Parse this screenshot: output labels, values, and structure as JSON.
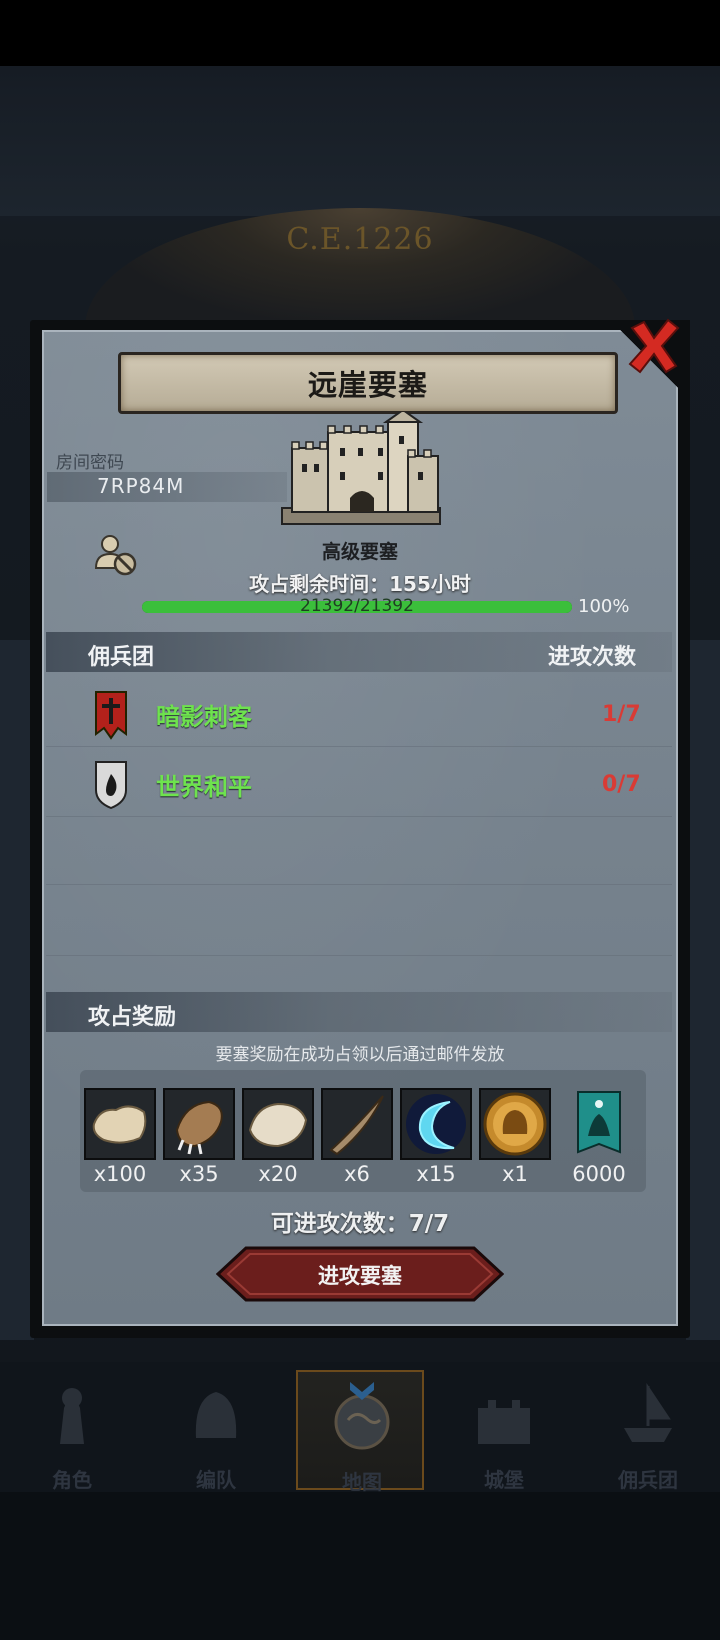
{
  "background": {
    "dial_year": "C.E.1226"
  },
  "fortress": {
    "title": "远崖要塞",
    "room_label": "房间密码",
    "room_code": "7RP84M",
    "type": "高级要塞",
    "time_left": "攻占剩余时间：155小时",
    "hp_text": "21392/21392",
    "hp_fraction": 1.0,
    "hp_percent": "100%"
  },
  "guilds": {
    "header": "佣兵团",
    "count_header": "进攻次数",
    "rows": [
      {
        "name": "暗影刺客",
        "count": "1/7",
        "icon": "red-cross-banner-icon"
      },
      {
        "name": "世界和平",
        "count": "0/7",
        "icon": "flame-shield-icon"
      }
    ]
  },
  "rewards": {
    "header": "攻占奖励",
    "note": "要塞奖励在成功占领以后通过邮件发放",
    "items": [
      {
        "icon": "fur-pelt-icon",
        "qty": "x100"
      },
      {
        "icon": "beast-claw-icon",
        "qty": "x35"
      },
      {
        "icon": "white-pelt-icon",
        "qty": "x20"
      },
      {
        "icon": "horn-icon",
        "qty": "x6"
      },
      {
        "icon": "blue-crescent-icon",
        "qty": "x15"
      },
      {
        "icon": "golden-helmet-medal-icon",
        "qty": "x1"
      },
      {
        "icon": "guild-banner-icon",
        "qty": "6000"
      }
    ]
  },
  "attempts": "可进攻次数：7/7",
  "attack_button": "进攻要塞",
  "nav": [
    {
      "label": "角色",
      "icon": "knight-icon",
      "active": false
    },
    {
      "label": "编队",
      "icon": "helmet-icon",
      "active": false
    },
    {
      "label": "地图",
      "icon": "globe-map-icon",
      "active": true
    },
    {
      "label": "城堡",
      "icon": "castle-icon",
      "active": false
    },
    {
      "label": "佣兵团",
      "icon": "ship-icon",
      "active": false
    }
  ],
  "colors": {
    "guild_name": "#6ee34e",
    "count": "#d93b35",
    "hp_bar": "#3bbf3b",
    "close": "#d42a22"
  }
}
